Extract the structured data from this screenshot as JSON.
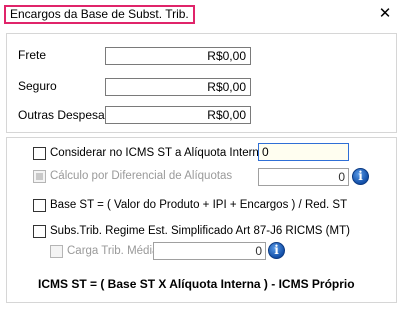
{
  "window": {
    "title": "Encargos da Base de Subst. Trib.",
    "close_glyph": "✕"
  },
  "charges": {
    "frete_label": "Frete",
    "frete_value": "R$0,00",
    "seguro_label": "Seguro",
    "seguro_value": "R$0,00",
    "outras_label": "Outras Despesas",
    "outras_value": "R$0,00"
  },
  "options": {
    "considerar_label": "Considerar no ICMS ST a Alíquota Interna:",
    "considerar_checked": false,
    "aliquota_interna_value": "0",
    "calculo_label": "Cálculo por Diferencial de Alíquotas",
    "calculo_value": "0",
    "base_st_label": "Base ST = ( Valor do Produto + IPI + Encargos ) / Red. ST",
    "base_st_checked": false,
    "subs_trib_label": "Subs.Trib. Regime Est. Simplificado Art 87-J6 RICMS (MT)",
    "subs_trib_checked": false,
    "carga_label": "Carga Trib. Média",
    "carga_value": "0",
    "info_glyph": "i"
  },
  "formula": "ICMS ST = ( Base ST X Alíquota Interna ) - ICMS Próprio",
  "colors": {
    "title_highlight": "#e0246a",
    "focus_border": "#2f6fd6",
    "info_icon": "#124fa8"
  }
}
